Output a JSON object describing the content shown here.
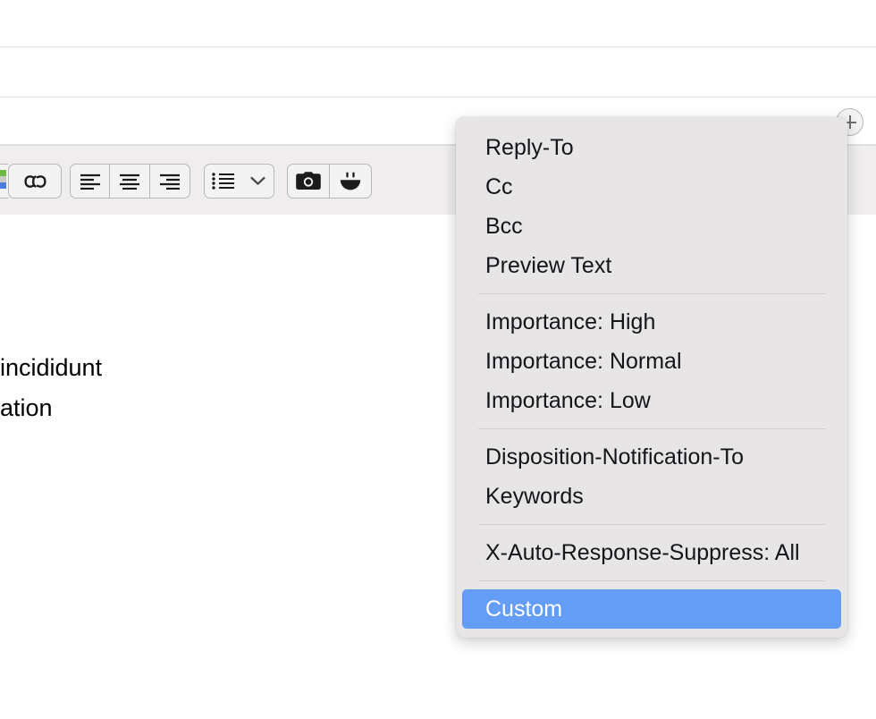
{
  "window": {
    "background_color": "#ffffff",
    "toolbar_background": "#efeded"
  },
  "compose_fields": {
    "dividers_y": [
      52,
      108,
      161
    ],
    "add_header_button": {
      "icon": "plus-circle-icon",
      "label": ""
    }
  },
  "format_toolbar": {
    "groups": [
      {
        "name": "color-and-link",
        "buttons": [
          {
            "icon": "color-swatch-icon",
            "label": ""
          },
          {
            "icon": "link-icon",
            "label": ""
          }
        ]
      },
      {
        "name": "alignment",
        "buttons": [
          {
            "icon": "align-left-icon",
            "label": ""
          },
          {
            "icon": "align-center-icon",
            "label": ""
          },
          {
            "icon": "align-right-icon",
            "label": ""
          }
        ]
      },
      {
        "name": "lists",
        "buttons": [
          {
            "icon": "bulleted-list-icon",
            "label": ""
          },
          {
            "icon": "chevron-down-icon",
            "label": ""
          }
        ]
      },
      {
        "name": "media",
        "buttons": [
          {
            "icon": "camera-icon",
            "label": ""
          },
          {
            "icon": "emoji-smiley-icon",
            "label": ""
          }
        ]
      }
    ]
  },
  "message_body": {
    "lines": [
      "incididunt",
      "ation"
    ]
  },
  "header_menu": {
    "highlight_color": "#649df5",
    "background_color": "#e7e5e5",
    "groups": [
      {
        "items": [
          {
            "label": "Reply-To",
            "selected": false
          },
          {
            "label": "Cc",
            "selected": false
          },
          {
            "label": "Bcc",
            "selected": false
          },
          {
            "label": "Preview Text",
            "selected": false
          }
        ]
      },
      {
        "items": [
          {
            "label": "Importance: High",
            "selected": false
          },
          {
            "label": "Importance: Normal",
            "selected": false
          },
          {
            "label": "Importance: Low",
            "selected": false
          }
        ]
      },
      {
        "items": [
          {
            "label": "Disposition-Notification-To",
            "selected": false
          },
          {
            "label": "Keywords",
            "selected": false
          }
        ]
      },
      {
        "items": [
          {
            "label": "X-Auto-Response-Suppress: All",
            "selected": false
          }
        ]
      },
      {
        "items": [
          {
            "label": "Custom",
            "selected": true
          }
        ]
      }
    ]
  }
}
